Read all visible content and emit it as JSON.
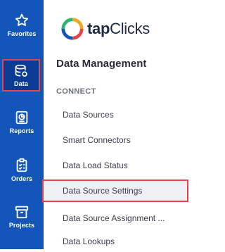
{
  "brand": {
    "name_part1": "tap",
    "name_part2": "Clicks",
    "colors": {
      "rail": "#1455b9",
      "rail_active": "#0a3c96",
      "highlight": "#e8434c"
    }
  },
  "rail": [
    {
      "label": "Favorites",
      "icon": "star-icon"
    },
    {
      "label": "Data",
      "icon": "database-icon",
      "active": true
    },
    {
      "label": "Reports",
      "icon": "report-icon"
    },
    {
      "label": "Orders",
      "icon": "clipboard-icon"
    },
    {
      "label": "Projects",
      "icon": "projects-icon"
    }
  ],
  "panel": {
    "title": "Data Management",
    "group_label": "CONNECT",
    "items": [
      {
        "label": "Data Sources"
      },
      {
        "label": "Smart Connectors"
      },
      {
        "label": "Data Load Status"
      },
      {
        "label": "Data Source Settings",
        "selected": true
      },
      {
        "label": "Data Source Assignment ..."
      },
      {
        "label": "Data Lookups"
      }
    ]
  }
}
